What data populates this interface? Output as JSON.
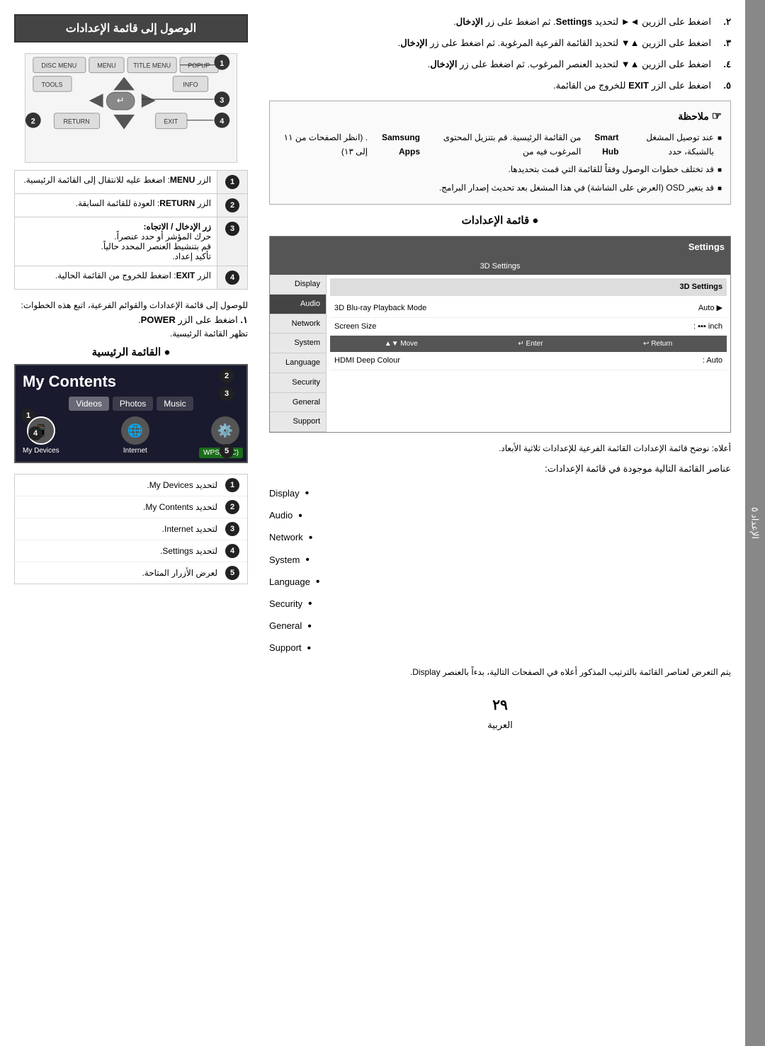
{
  "page": {
    "number": "٢٩",
    "label": "العربية"
  },
  "side_tab": {
    "text": "الإعداد",
    "number": "٥"
  },
  "right_col": {
    "main_header": "الوصول إلى قائمة الإعدادات",
    "remote_buttons": {
      "row1": [
        "DISC MENU",
        "MENU",
        "TITLE MENU"
      ],
      "row2": [
        "TOOLS",
        "▲",
        "INFO"
      ],
      "row3": [
        "◄",
        "↵",
        "►"
      ],
      "row4": [
        "RETURN",
        "▼",
        "EXIT"
      ]
    },
    "annotations": [
      {
        "num": "1",
        "label": "MENU"
      },
      {
        "num": "2",
        "label": "RETURN"
      },
      {
        "num": "3",
        "label": "الإدخال / الاتجاه"
      },
      {
        "num": "4",
        "label": "EXIT"
      }
    ],
    "instruction_table": [
      {
        "badge": "1",
        "text": "الزر MENU: اضغط عليه للانتقال إلى القائمة الرئيسية."
      },
      {
        "badge": "2",
        "text": "الزر RETURN: العودة للقائمة السابقة."
      },
      {
        "badge": "3",
        "title": "زر الإدخال / الاتجاه:",
        "text": "حرك المؤشر أو حدد عنصراً.\nقم بتنشيط العنصر المحدد حالياً.\nتأكيد إعداد."
      },
      {
        "badge": "4",
        "text": "الزر EXIT: اضغط للخروج من القائمة الحالية."
      }
    ],
    "access_instructions_title": "للوصول إلى قائمة الإعدادات والقوائم الفرعية، اتبع هذه الخطوات:",
    "access_step1": "اضغط على الزر POWER.",
    "access_step1_desc": "تظهر القائمة الرئيسية.",
    "main_menu_label": "القائمة الرئيسية",
    "mycontents": {
      "title": "My Contents",
      "menu_items": [
        "Videos",
        "Photos",
        "Music"
      ],
      "bottom_icons": [
        {
          "label": "My Devices",
          "num": "1"
        },
        {
          "label": "Internet",
          "num": "3"
        },
        {
          "label": "Settings",
          "num": "4"
        }
      ],
      "wps_label": "WPS(PBC)"
    },
    "nav_legend": [
      {
        "badge": "1",
        "text": "لتحديد My Devices."
      },
      {
        "badge": "2",
        "text": "لتحديد My Contents."
      },
      {
        "badge": "3",
        "text": "لتحديد Internet."
      },
      {
        "badge": "4",
        "text": "لتحديد Settings."
      },
      {
        "badge": "5",
        "text": "لعرض الأزرار المتاحة."
      }
    ]
  },
  "left_col": {
    "steps": [
      {
        "num": "٢.",
        "text": "اضغط على الزرين ◄► لتحديد Settings. ثم اضغط على زر الإدخال."
      },
      {
        "num": "٣.",
        "text": "اضغط على الزرين ▲▼ لتحديد القائمة الفرعية المرغوبة. ثم اضغط على زر الإدخال."
      },
      {
        "num": "٤.",
        "text": "اضغط على الزرين ▲▼ لتحديد العنصر المرغوب. ثم اضغط على زر الإدخال."
      },
      {
        "num": "٥.",
        "text": "اضغط على الزر EXIT للخروج من القائمة."
      }
    ],
    "note_title": "ملاحظة",
    "notes": [
      "عند توصيل المشغل بالشبكة، حدد Smart Hub من القائمة الرئيسية. قم بتنزيل المحتوى المرغوب فيه من Samsung Apps. (انظر الصفحات من ١١ إلى ١٣)",
      "قد تختلف خطوات الوصول وفقاً للقائمة التي قمت بتحديدها.",
      "قد يتغير OSD (العرض على الشاشة) في هذا المشغل بعد تحديث إصدار البرامج."
    ],
    "settings_menu_title": "قائمة الإعدادات",
    "settings_box": {
      "title": "Settings",
      "tabs": [
        "3D Settings"
      ],
      "sidebar": [
        "Display",
        "Audio",
        "Network",
        "System",
        "Language",
        "Security",
        "General",
        "Support"
      ],
      "active_sidebar": "Audio",
      "active_sub": "3D Settings",
      "rows": [
        {
          "label": "3D Blu-ray Playback Mode",
          "value": "Auto",
          "arrow": true
        },
        {
          "label": "Screen Size",
          "value": "inch"
        }
      ],
      "nav": [
        "▲▼ Move",
        "↵ Enter",
        "↩ Return"
      ],
      "extra_row": {
        "label": "HDMI Deep Colour",
        "value": "Auto"
      }
    },
    "settings_note": "أعلاه: نوضح قائمة الإعدادات القائمة الفرعية للإعدادات ثلاثية الأبعاد.",
    "elements_title": "عناصر القائمة التالية موجودة في قائمة الإعدادات:",
    "elements": [
      "Display",
      "Audio",
      "Network",
      "System",
      "Language",
      "Security",
      "General",
      "Support"
    ],
    "display_note": "يتم التعرض لعناصر القائمة بالترتيب المذكور أعلاه في الصفحات التالية، بدءاً بالعنصر Display."
  }
}
